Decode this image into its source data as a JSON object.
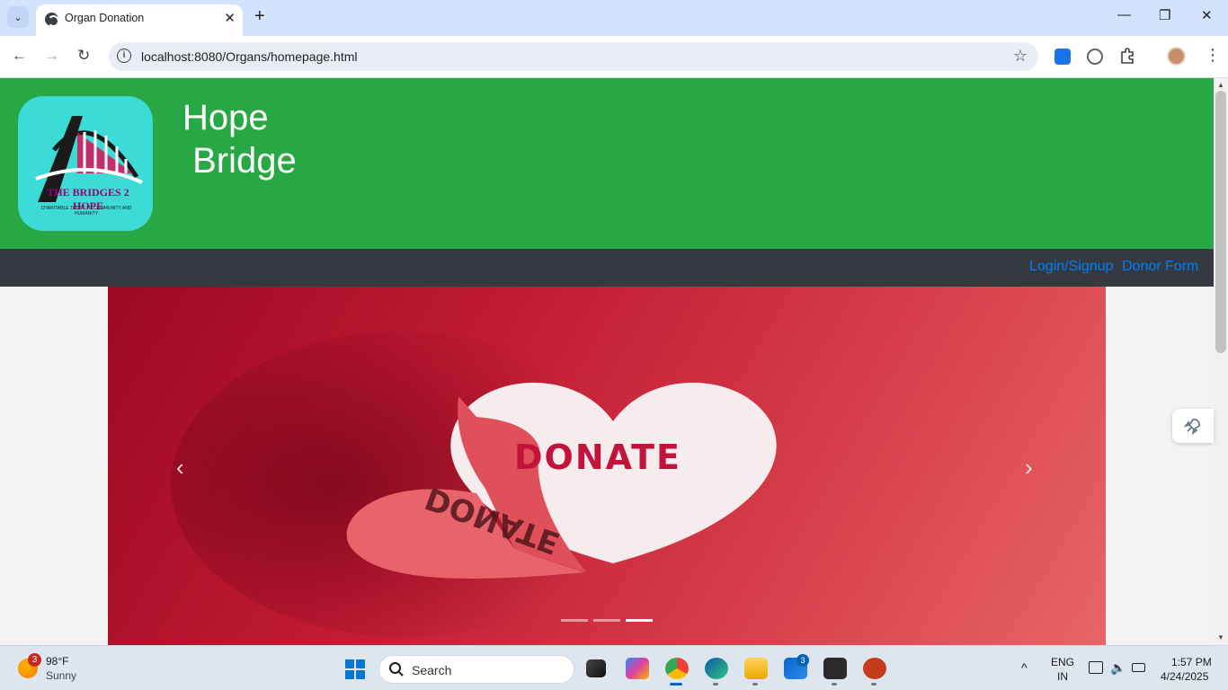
{
  "browser": {
    "tab_title": "Organ Donation",
    "url": "localhost:8080/Organs/homepage.html",
    "tab_close": "✕",
    "new_tab": "+",
    "back": "←",
    "forward": "→",
    "reload": "↻",
    "bookmark": "☆",
    "minimize": "—",
    "restore": "❐",
    "close": "✕",
    "menu": "⋮",
    "tab_list": "⌄"
  },
  "site": {
    "brand": "Hope\n Bridge",
    "logo": {
      "name": "THE BRIDGES 2 HOPE",
      "tagline": "CHARITABLE TRUST TO COMMUNITY AND HUMANITY"
    },
    "nav": {
      "login": "Login/Signup",
      "donor_form": "Donor Form"
    },
    "carousel": {
      "slide_text": "DONATE",
      "slide_text_mirror": "DONATE",
      "prev": "‹",
      "next": "›",
      "indicators": 3,
      "active_index": 2
    }
  },
  "taskbar": {
    "weather": {
      "badge": "3",
      "temp": "98°F",
      "condition": "Sunny"
    },
    "search_placeholder": "Search",
    "mail_badge": "3",
    "language": "ENG",
    "region": "IN",
    "time": "1:57 PM",
    "date": "4/24/2025",
    "tray_chevron": "^"
  },
  "colors": {
    "header_green": "#28a745",
    "navbar_dark": "#343a40",
    "link_blue": "#007bff",
    "logo_teal": "#3ddbd5"
  }
}
